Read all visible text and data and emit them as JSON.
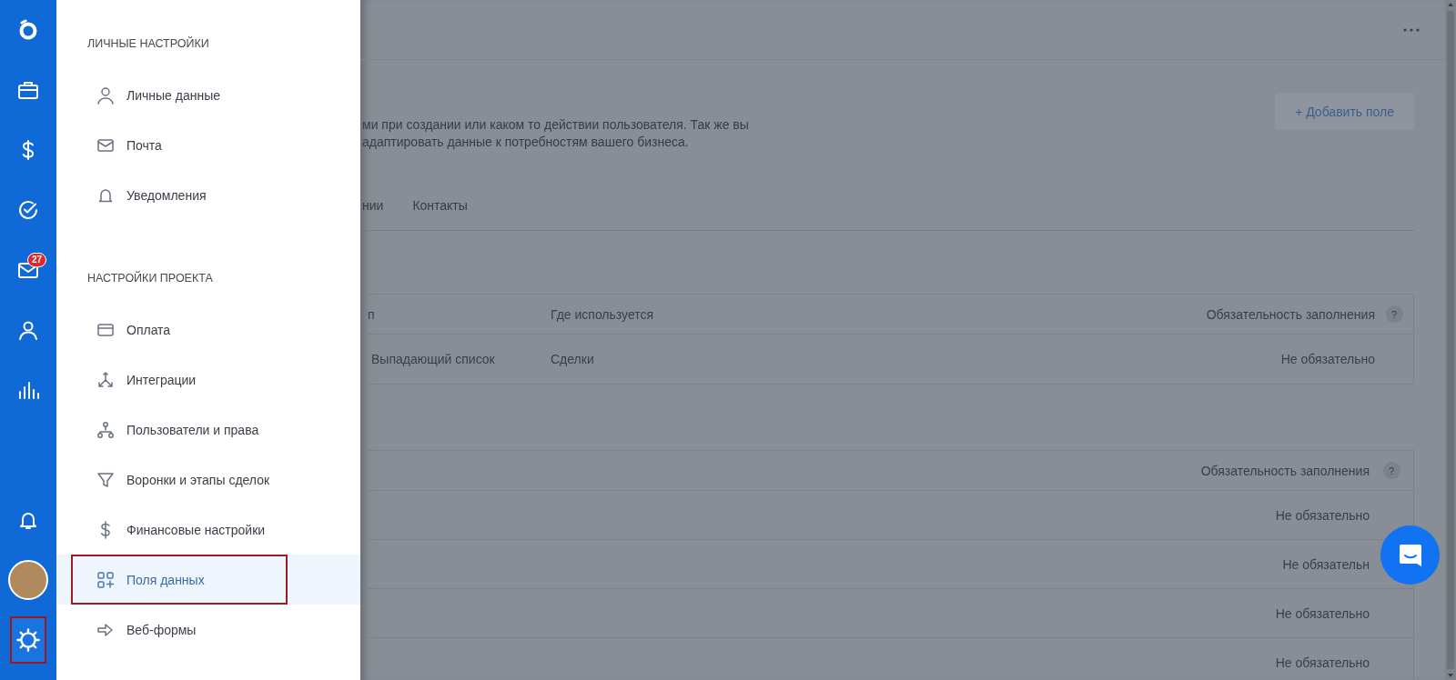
{
  "rail": {
    "items": [
      {
        "selected": false
      },
      {
        "selected": false
      },
      {
        "selected": false
      },
      {
        "selected": false,
        "badge": "27"
      },
      {
        "selected": false
      },
      {
        "selected": false
      }
    ],
    "bottom_items": [
      {
        "selected": false
      },
      {
        "selected": false
      },
      {
        "selected": true
      }
    ]
  },
  "drawer": {
    "sections": [
      {
        "heading": "ЛИЧНЫЕ НАСТРОЙКИ",
        "items": [
          {
            "label": "Личные данные",
            "selected": false
          },
          {
            "label": "Почта",
            "selected": false
          },
          {
            "label": "Уведомления",
            "selected": false
          }
        ]
      },
      {
        "heading": "НАСТРОЙКИ ПРОЕКТА",
        "items": [
          {
            "label": "Оплата",
            "selected": false
          },
          {
            "label": "Интеграции",
            "selected": false
          },
          {
            "label": "Пользователи и права",
            "selected": false
          },
          {
            "label": "Воронки и этапы сделок",
            "selected": false
          },
          {
            "label": "Финансовые настройки",
            "selected": false
          },
          {
            "label": "Поля данных",
            "selected": true
          },
          {
            "label": "Веб-формы",
            "selected": false
          }
        ]
      }
    ]
  },
  "page": {
    "add_button": "+ Добавить поле",
    "description_lines": [
      "ми при создании или каком то действии пользователя. Так же вы",
      "адаптировать данные к потребностям вашего бизнеса."
    ],
    "tabs": [
      {
        "label": "нии"
      },
      {
        "label": "Контакты"
      }
    ],
    "tables": [
      {
        "columns": [
          "п",
          "Где используется",
          "Обязательность заполнения"
        ],
        "help_mark": "?",
        "rows": [
          [
            "Выпадающий список",
            "Сделки",
            "Не обязательно"
          ]
        ]
      },
      {
        "columns": [
          "Обязательность заполнения"
        ],
        "help_mark": "?",
        "rows": [
          [
            "Не обязательно"
          ],
          [
            "Не обязательн"
          ],
          [
            "Не обязательно"
          ],
          [
            "Не обязательно"
          ]
        ]
      }
    ]
  }
}
